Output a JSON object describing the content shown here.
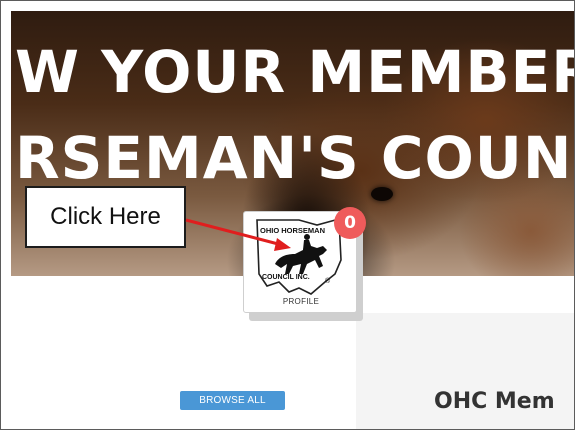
{
  "hero": {
    "line1": "W YOUR MEMBER",
    "line2": "RSEMAN'S COUNC"
  },
  "callout": {
    "text": "Click Here"
  },
  "profile": {
    "logo_line1": "OHIO HORSEMAN",
    "logo_line2": "COUNCIL INC.",
    "logo_mark": "®",
    "label": "PROFILE",
    "notification_count": "0"
  },
  "content": {
    "browse_button": "BROWSE ALL",
    "section_title": "OHC Mem"
  },
  "colors": {
    "badge": "#ef5b5b",
    "button": "#4a97d6",
    "arrow": "#e01e1e",
    "panel": "#f4f4f4"
  },
  "icons": {
    "logo": "ohio-horseman-council-logo",
    "arrow": "red-pointer-arrow"
  }
}
